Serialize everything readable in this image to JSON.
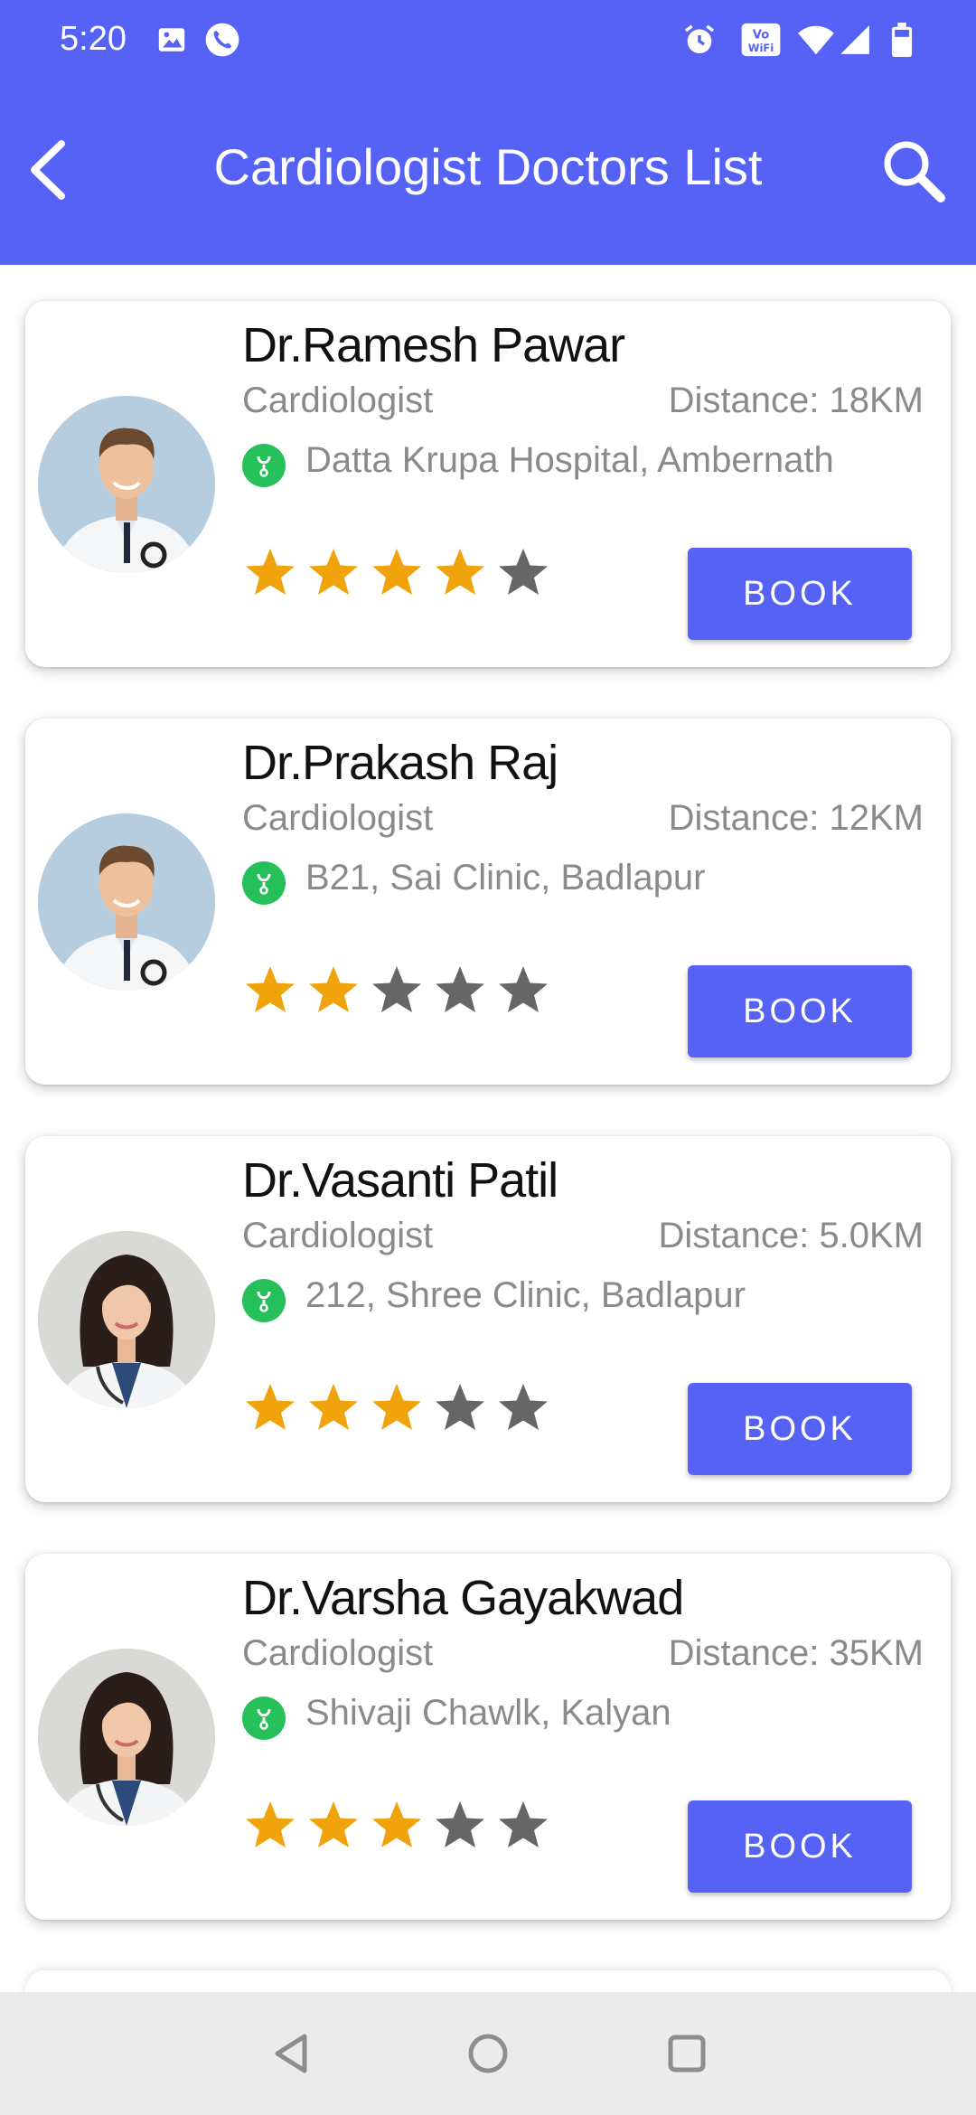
{
  "status_bar": {
    "time": "5:20",
    "icons": [
      "image-icon",
      "call-icon",
      "alarm-icon",
      "vowifi-icon",
      "wifi-icon",
      "signal-icon",
      "battery-icon"
    ]
  },
  "app_bar": {
    "title": "Cardiologist Doctors List",
    "back_icon": "chevron-left-icon",
    "search_icon": "search-icon",
    "color": "#5661f6"
  },
  "doctors": [
    {
      "name": "Dr.Ramesh Pawar",
      "specialty": "Cardiologist",
      "distance": "Distance: 18KM",
      "hospital": "Datta Krupa Hospital, Ambernath",
      "rating": 4,
      "max_rating": 5,
      "book_label": "BOOK",
      "avatar": "male-doctor"
    },
    {
      "name": "Dr.Prakash Raj",
      "specialty": "Cardiologist",
      "distance": "Distance: 12KM",
      "hospital": "B21, Sai Clinic, Badlapur",
      "rating": 2,
      "max_rating": 5,
      "book_label": "BOOK",
      "avatar": "male-doctor"
    },
    {
      "name": "Dr.Vasanti Patil",
      "specialty": "Cardiologist",
      "distance": "Distance: 5.0KM",
      "hospital": "212, Shree Clinic, Badlapur",
      "rating": 3,
      "max_rating": 5,
      "book_label": "BOOK",
      "avatar": "female-doctor"
    },
    {
      "name": "Dr.Varsha Gayakwad",
      "specialty": "Cardiologist",
      "distance": "Distance: 35KM",
      "hospital": "Shivaji Chawlk, Kalyan",
      "rating": 3,
      "max_rating": 5,
      "book_label": "BOOK",
      "avatar": "female-doctor"
    }
  ],
  "colors": {
    "accent": "#5661f6",
    "star_filled": "#f0a30a",
    "star_empty": "#666666",
    "hospital_badge": "#25c05a"
  },
  "nav_bar": {
    "buttons": [
      "back-triangle-icon",
      "home-circle-icon",
      "recents-square-icon"
    ]
  }
}
